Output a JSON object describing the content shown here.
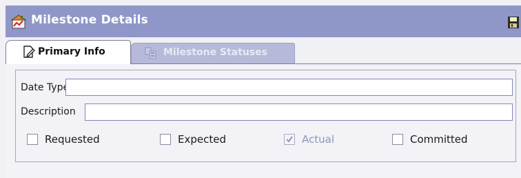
{
  "header": {
    "title": "Milestone Details",
    "icon": "milestone-chart-icon",
    "save_icon": "save-disk-icon"
  },
  "tabs": [
    {
      "label": "Primary Info",
      "icon": "edit-document-icon",
      "active": true
    },
    {
      "label": "Milestone Statuses",
      "icon": "statuses-icon",
      "active": false
    }
  ],
  "form": {
    "date_type": {
      "label": "Date Type",
      "value": ""
    },
    "description": {
      "label": "Description",
      "value": ""
    },
    "checkboxes": [
      {
        "label": "Requested",
        "checked": false,
        "disabled": false
      },
      {
        "label": "Expected",
        "checked": false,
        "disabled": false
      },
      {
        "label": "Actual",
        "checked": true,
        "disabled": true
      },
      {
        "label": "Committed",
        "checked": false,
        "disabled": false
      }
    ]
  },
  "colors": {
    "titlebar": "#8f97c8",
    "inactive_tab": "#b6bad8",
    "input_border": "#7f86b8",
    "panel_bg": "#f2f2f7"
  }
}
